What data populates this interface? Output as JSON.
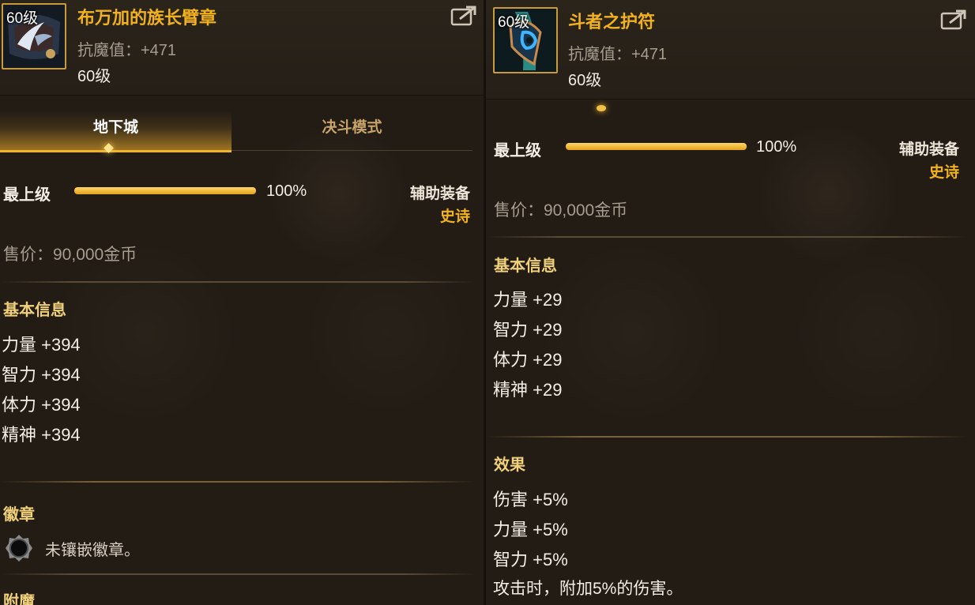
{
  "left": {
    "level_badge": "60级",
    "name": "布万加的族长臂章",
    "magic_resist": "抗魔值：+471",
    "level": "60级",
    "tabs": [
      {
        "label": "地下城",
        "active": true
      },
      {
        "label": "决斗模式",
        "active": false
      }
    ],
    "grade": {
      "label": "最上级",
      "percent": 100,
      "percent_label": "100%"
    },
    "slot_type": "辅助装备",
    "rarity": "史诗",
    "price": "售价：90,000金币",
    "basic_info": {
      "title": "基本信息",
      "lines": [
        "力量 +394",
        "智力 +394",
        "体力 +394",
        "精神 +394"
      ]
    },
    "emblem": {
      "title": "徽章",
      "text": "未镶嵌徽章。"
    },
    "enchant_title": "附魔"
  },
  "right": {
    "level_badge": "60级",
    "name": "斗者之护符",
    "magic_resist": "抗魔值：+471",
    "level": "60级",
    "grade": {
      "label": "最上级",
      "percent": 100,
      "percent_label": "100%"
    },
    "slot_type": "辅助装备",
    "rarity": "史诗",
    "price": "售价：90,000金币",
    "basic_info": {
      "title": "基本信息",
      "lines": [
        "力量 +29",
        "智力 +29",
        "体力 +29",
        "精神 +29"
      ]
    },
    "effects": {
      "title": "效果",
      "lines": [
        "伤害 +5%",
        "力量 +5%",
        "智力 +5%",
        "攻击时，附加5%的伤害。"
      ]
    }
  },
  "colors": {
    "accent_gold": "#f2b21d",
    "section_title": "#f0d07a",
    "muted_text": "#a79d8f",
    "panel_bg": "#221c15"
  },
  "icons": [
    "armband-item-icon",
    "amulet-item-icon",
    "share-icon",
    "emblem-slot-icon"
  ]
}
